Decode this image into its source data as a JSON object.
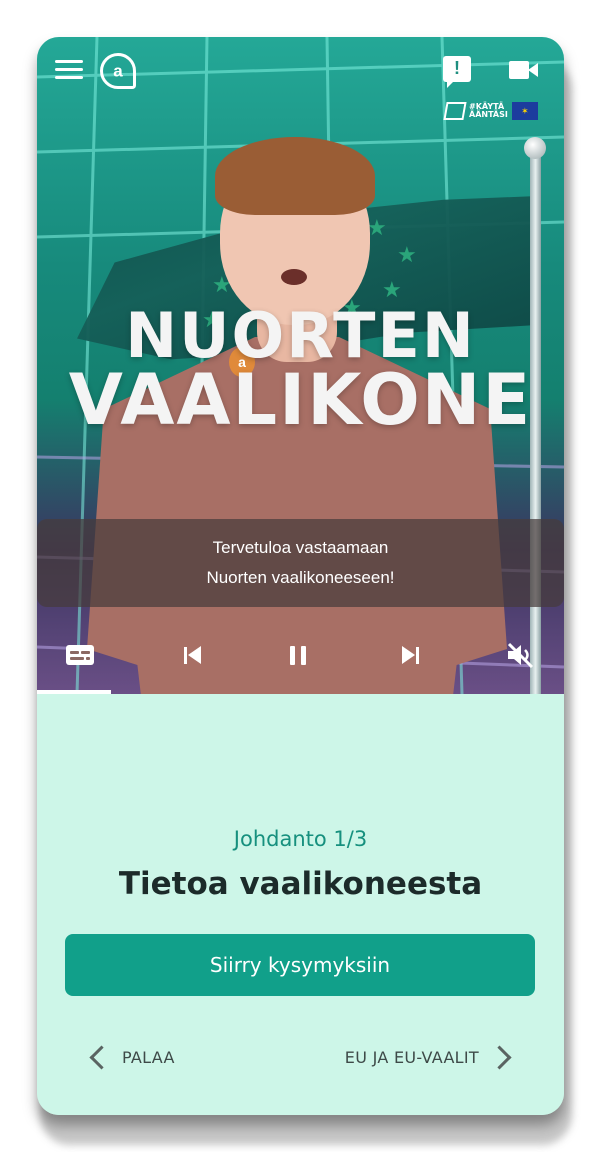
{
  "video": {
    "logo_line1": "NUORTEN",
    "logo_line2": "VAALIKONE",
    "campaign_tag_line1": "#KÄYTÄ",
    "campaign_tag_line2": "ÄÄNTÄSI",
    "subtitle_line1": "Tervetuloa vastaamaan",
    "subtitle_line2": "Nuorten vaalikoneeseen!",
    "progress_fraction": 0.14
  },
  "icons": {
    "menu": "hamburger-icon",
    "brand": "chat-bubble-logo",
    "report": "report-flag-icon",
    "camera": "video-camera-icon",
    "eu": "eu-flag-icon",
    "captions": "captions-icon",
    "prev": "skip-previous-icon",
    "pause": "pause-icon",
    "next": "skip-next-icon",
    "mute": "volume-muted-icon"
  },
  "panel": {
    "step_label": "Johdanto 1/3",
    "title": "Tietoa vaalikoneesta",
    "primary_button": "Siirry kysymyksiin",
    "back_label": "PALAA",
    "next_label": "EU JA EU-VAALIT"
  },
  "colors": {
    "accent": "#11a08a",
    "accent_text": "#16907e",
    "panel_bg": "#cdf6e8",
    "title_text": "#1c2b2a"
  }
}
